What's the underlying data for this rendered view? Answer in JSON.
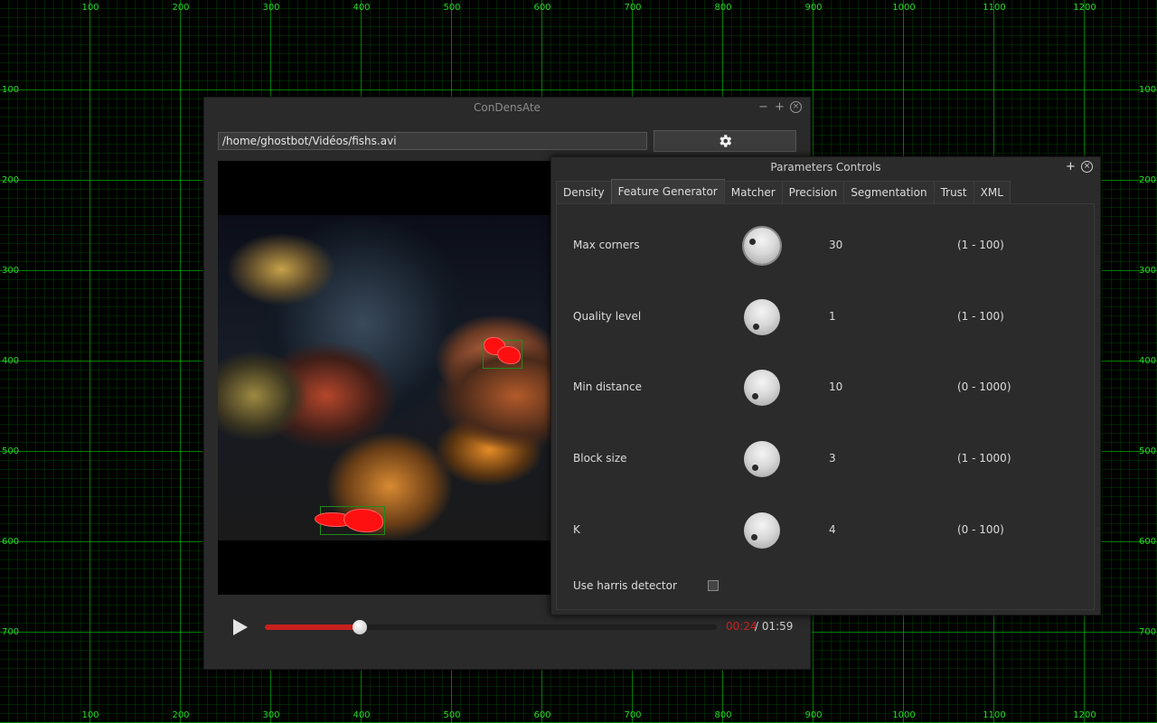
{
  "ruler": {
    "top": [
      "100",
      "200",
      "300",
      "400",
      "500",
      "600",
      "700",
      "800",
      "900",
      "1000",
      "1100",
      "1200"
    ],
    "left": [
      "100",
      "200",
      "300",
      "400",
      "500",
      "600",
      "700"
    ]
  },
  "main_window": {
    "title": "ConDensAte",
    "controls": {
      "minimize": "−",
      "maximize": "+",
      "close": "×"
    },
    "path_value": "/home/ghostbot/Vidéos/fishs.avi",
    "gear_button_icon": "gear-icon",
    "player": {
      "play_icon": "play-icon",
      "progress": 0.21,
      "current_time": "00:24",
      "separator_total": "/ 01:59",
      "accent": "#c8201c"
    }
  },
  "params_window": {
    "title": "Parameters Controls",
    "controls": {
      "maximize": "+",
      "close": "×"
    },
    "tabs": [
      "Density",
      "Feature Generator",
      "Matcher",
      "Precision",
      "Segmentation",
      "Trust",
      "XML"
    ],
    "active_tab": "Feature Generator",
    "params": [
      {
        "label": "Max corners",
        "value": "30",
        "range": "(1 - 100)"
      },
      {
        "label": "Quality level",
        "value": "1",
        "range": "(1 - 100)"
      },
      {
        "label": "Min distance",
        "value": "10",
        "range": "(0 - 1000)"
      },
      {
        "label": "Block size",
        "value": "3",
        "range": "(1 - 1000)"
      },
      {
        "label": "K",
        "value": "4",
        "range": "(0 - 100)"
      }
    ],
    "harris": {
      "label": "Use harris detector",
      "checked": false
    }
  },
  "colors": {
    "grid": "#00c800",
    "ruler_text": "#27d827",
    "window_bg": "#2a2a2a"
  }
}
